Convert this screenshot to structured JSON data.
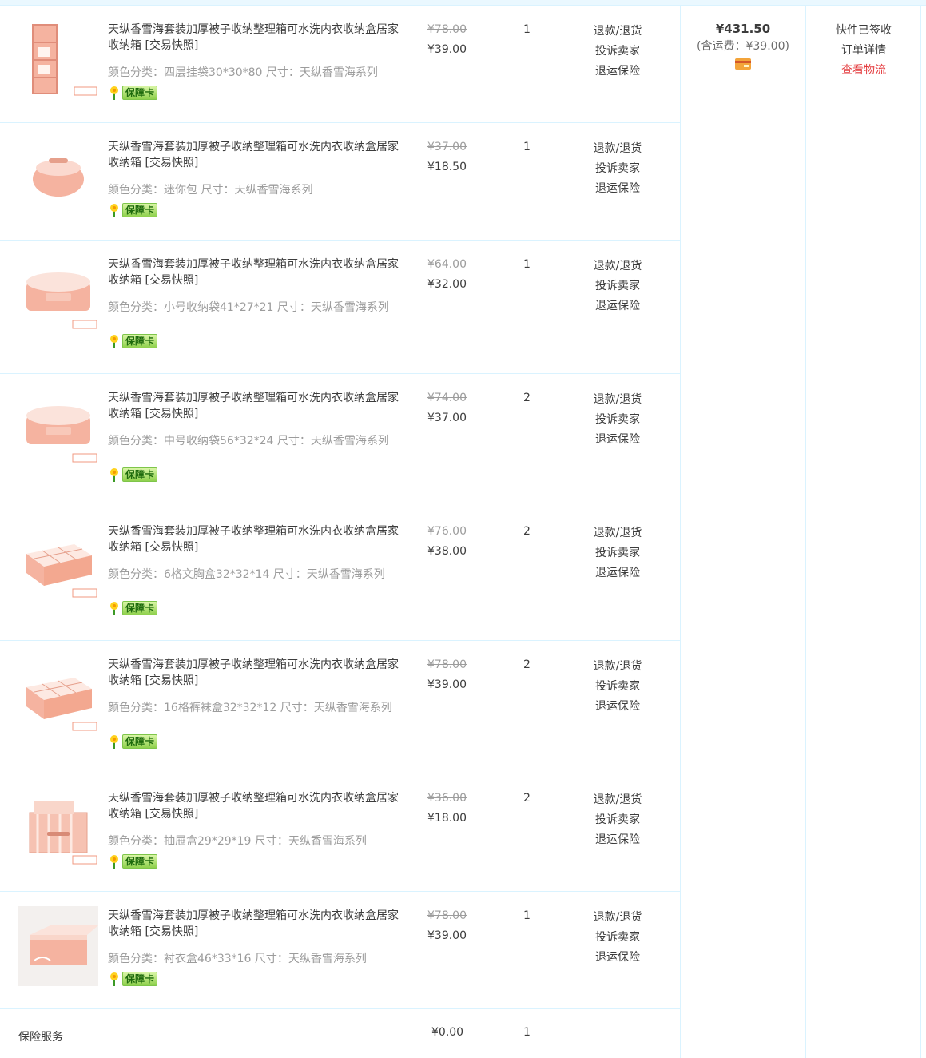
{
  "items": [
    {
      "title": "天纵香雪海套装加厚被子收纳整理箱可水洗内衣收纳盒居家收纳箱 [交易快照]",
      "sku": "颜色分类：四层挂袋30*30*80   尺寸：天纵香雪海系列",
      "original_price": "¥78.00",
      "price": "¥39.00",
      "qty": "1",
      "badge": "保障卡",
      "thumb_icon": "hanging-organizer-icon"
    },
    {
      "title": "天纵香雪海套装加厚被子收纳整理箱可水洗内衣收纳盒居家收纳箱 [交易快照]",
      "sku": "颜色分类：迷你包   尺寸：天纵香雪海系列",
      "original_price": "¥37.00",
      "price": "¥18.50",
      "qty": "1",
      "badge": "保障卡",
      "thumb_icon": "mini-bag-icon"
    },
    {
      "title": "天纵香雪海套装加厚被子收纳整理箱可水洗内衣收纳盒居家收纳箱 [交易快照]",
      "sku": "颜色分类：小号收纳袋41*27*21   尺寸：天纵香雪海系列",
      "original_price": "¥64.00",
      "price": "¥32.00",
      "qty": "1",
      "badge": "保障卡",
      "thumb_icon": "storage-bag-icon"
    },
    {
      "title": "天纵香雪海套装加厚被子收纳整理箱可水洗内衣收纳盒居家收纳箱 [交易快照]",
      "sku": "颜色分类：中号收纳袋56*32*24   尺寸：天纵香雪海系列",
      "original_price": "¥74.00",
      "price": "¥37.00",
      "qty": "2",
      "badge": "保障卡",
      "thumb_icon": "storage-bag-icon"
    },
    {
      "title": "天纵香雪海套装加厚被子收纳整理箱可水洗内衣收纳盒居家收纳箱 [交易快照]",
      "sku": "颜色分类：6格文胸盒32*32*14   尺寸：天纵香雪海系列",
      "original_price": "¥76.00",
      "price": "¥38.00",
      "qty": "2",
      "badge": "保障卡",
      "thumb_icon": "grid-box-icon"
    },
    {
      "title": "天纵香雪海套装加厚被子收纳整理箱可水洗内衣收纳盒居家收纳箱 [交易快照]",
      "sku": "颜色分类：16格裤袜盒32*32*12   尺寸：天纵香雪海系列",
      "original_price": "¥78.00",
      "price": "¥39.00",
      "qty": "2",
      "badge": "保障卡",
      "thumb_icon": "grid-box-icon"
    },
    {
      "title": "天纵香雪海套装加厚被子收纳整理箱可水洗内衣收纳盒居家收纳箱 [交易快照]",
      "sku": "颜色分类：抽屉盒29*29*19   尺寸：天纵香雪海系列",
      "original_price": "¥36.00",
      "price": "¥18.00",
      "qty": "2",
      "badge": "保障卡",
      "thumb_icon": "drawer-box-icon"
    },
    {
      "title": "天纵香雪海套装加厚被子收纳整理箱可水洗内衣收纳盒居家收纳箱 [交易快照]",
      "sku": "颜色分类：衬衣盒46*33*16   尺寸：天纵香雪海系列",
      "original_price": "¥78.00",
      "price": "¥39.00",
      "qty": "1",
      "badge": "保障卡",
      "thumb_icon": "shirt-box-icon"
    }
  ],
  "ops": [
    "退款/退货",
    "投诉卖家",
    "退运保险"
  ],
  "insurance": {
    "label": "保险服务",
    "price": "¥0.00",
    "qty": "1"
  },
  "total": {
    "amount": "¥431.50",
    "shipping": "(含运费：¥39.00)",
    "payment_icon": "card-icon"
  },
  "status": {
    "state": "快件已签收",
    "detail_link": "订单详情",
    "logistics_link": "查看物流"
  },
  "colors": {
    "border": "#daf3ff",
    "link_red": "#e4393c",
    "product_pink": "#f5b3a0"
  }
}
